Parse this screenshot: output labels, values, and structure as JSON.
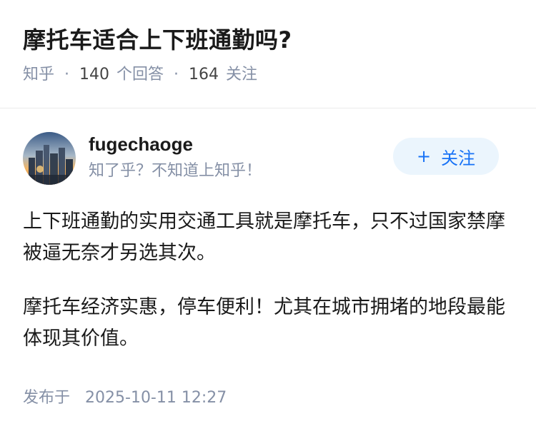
{
  "question": {
    "title": "摩托车适合上下班通勤吗?",
    "source": "知乎",
    "answer_count": "140",
    "answer_label": "个回答",
    "follower_count": "164",
    "follower_label": "关注"
  },
  "answer": {
    "author": {
      "name": "fugechaoge",
      "bio": "知了乎？不知道上知乎！",
      "avatar_icon": "city-skyline-sunset-avatar"
    },
    "follow_button": {
      "icon": "+",
      "label": "关注"
    },
    "paragraphs": [
      "上下班通勤的实用交通工具就是摩托车，只不过国家禁摩被逼无奈才另选其次。",
      "摩托车经济实惠，停车便利！尤其在城市拥堵的地段最能体现其价值。"
    ],
    "published_label": "发布于",
    "published_time": "2025-10-11 12:27"
  },
  "colors": {
    "meta_gray": "#8590a6",
    "follow_blue": "#1772f6",
    "follow_bg": "#ebf5fd"
  }
}
